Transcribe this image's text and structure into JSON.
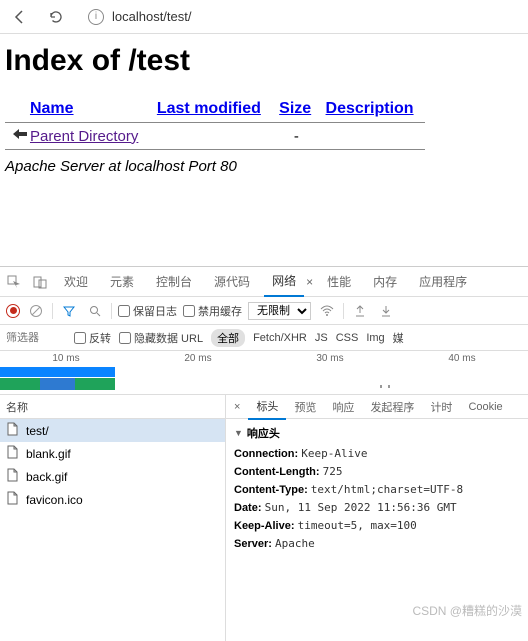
{
  "browser": {
    "url": "localhost/test/"
  },
  "page": {
    "heading": "Index of /test",
    "columns": {
      "name": "Name",
      "modified": "Last modified",
      "size": "Size",
      "desc": "Description"
    },
    "parent": "Parent Directory",
    "parent_size": "-",
    "server": "Apache Server at localhost Port 80"
  },
  "devtools": {
    "tabs": {
      "welcome": "欢迎",
      "elements": "元素",
      "console": "控制台",
      "sources": "源代码",
      "network": "网络",
      "performance": "性能",
      "memory": "内存",
      "application": "应用程序"
    },
    "toolbar": {
      "preserve": "保留日志",
      "disable_cache": "禁用缓存",
      "throttle": "无限制"
    },
    "filter": {
      "placeholder": "筛选器",
      "invert": "反转",
      "hide_data": "隐藏数据 URL",
      "all": "全部",
      "types": [
        "Fetch/XHR",
        "JS",
        "CSS",
        "Img",
        "媒"
      ]
    },
    "timeline": {
      "t1": "10 ms",
      "t2": "20 ms",
      "t3": "30 ms",
      "t4": "40 ms"
    },
    "name_col": "名称",
    "files": [
      "test/",
      "blank.gif",
      "back.gif",
      "favicon.ico"
    ],
    "detail_tabs": {
      "headers": "标头",
      "preview": "预览",
      "response": "响应",
      "initiator": "发起程序",
      "timing": "计时",
      "cookies": "Cookie"
    },
    "response_headers_title": "响应头",
    "headers": [
      {
        "k": "Connection:",
        "v": "Keep-Alive"
      },
      {
        "k": "Content-Length:",
        "v": "725"
      },
      {
        "k": "Content-Type:",
        "v": "text/html;charset=UTF-8"
      },
      {
        "k": "Date:",
        "v": "Sun, 11 Sep 2022 11:56:36 GMT"
      },
      {
        "k": "Keep-Alive:",
        "v": "timeout=5, max=100"
      },
      {
        "k": "Server:",
        "v": "Apache"
      }
    ]
  },
  "watermark": "CSDN @糟糕的沙漠"
}
